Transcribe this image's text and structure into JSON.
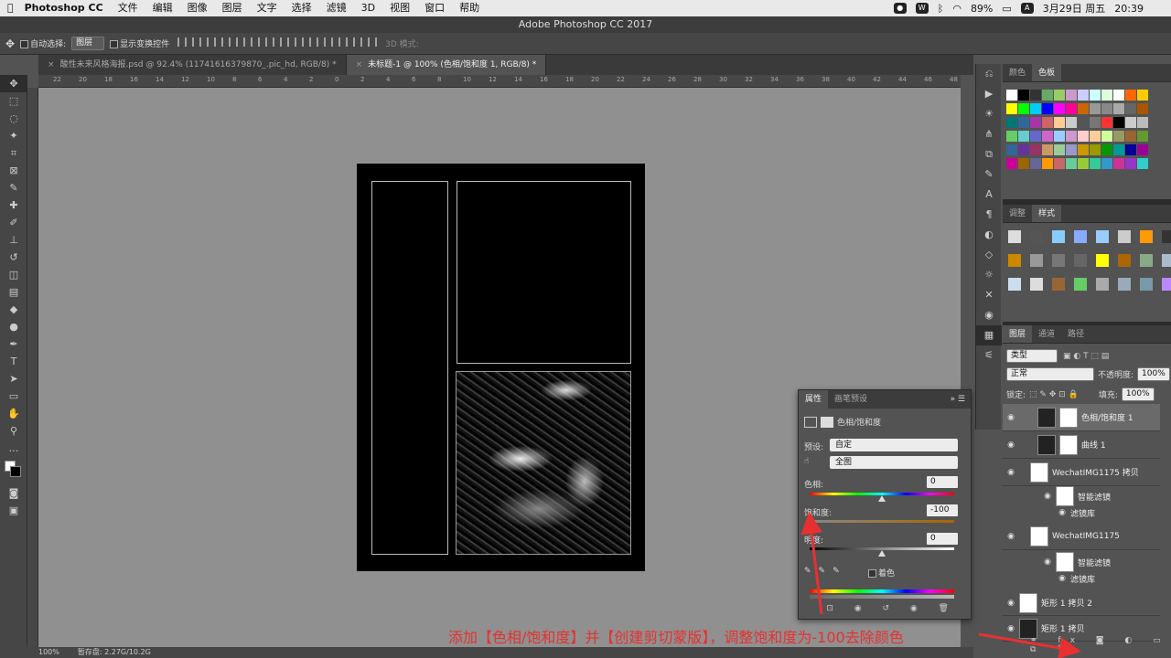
{
  "menubar": {
    "app": "Photoshop CC",
    "items": [
      "文件",
      "编辑",
      "图像",
      "图层",
      "文字",
      "选择",
      "滤镜",
      "3D",
      "视图",
      "窗口",
      "帮助"
    ],
    "battery": "89%",
    "date": "3月29日 周五",
    "time": "20:39",
    "input": "A"
  },
  "window": {
    "title": "Adobe Photoshop CC 2017"
  },
  "options": {
    "auto_select": "自动选择:",
    "layer_select": "图层",
    "show_transform": "显示变换控件",
    "mode3d": "3D 模式:"
  },
  "tabs": [
    {
      "label": "酸性未来风格海报.psd @ 92.4% (11741616379870_.pic_hd, RGB/8) *"
    },
    {
      "label": "未标题-1 @ 100% (色相/饱和度 1, RGB/8) *"
    }
  ],
  "ruler": {
    "marks": [
      "22",
      "20",
      "18",
      "16",
      "14",
      "12",
      "10",
      "8",
      "6",
      "4",
      "2",
      "0",
      "2",
      "4",
      "6",
      "8",
      "10",
      "12",
      "14",
      "16",
      "18",
      "20",
      "22",
      "24",
      "26",
      "28",
      "30",
      "32",
      "34",
      "36",
      "38",
      "40",
      "42",
      "44",
      "46",
      "48"
    ]
  },
  "status": {
    "zoom": "100%",
    "doc": "暂存盘: 2.27G/10.2G"
  },
  "swatches_panel": {
    "tabs": [
      "颜色",
      "色板"
    ]
  },
  "styles_panel": {
    "tabs": [
      "调整",
      "样式"
    ]
  },
  "layers_panel": {
    "tabs": [
      "图层",
      "通道",
      "路径"
    ],
    "filter": "类型",
    "blend": "正常",
    "opacity_label": "不透明度:",
    "opacity": "100%",
    "lock_label": "锁定:",
    "fill_label": "填充:",
    "fill": "100%",
    "layers": [
      {
        "name": "色相/饱和度 1"
      },
      {
        "name": "曲线 1"
      },
      {
        "name": "WechatIMG1175 拷贝"
      },
      {
        "name": "智能滤镜"
      },
      {
        "name": "滤镜库"
      },
      {
        "name": "WechatIMG1175"
      },
      {
        "name": "智能滤镜"
      },
      {
        "name": "滤镜库"
      },
      {
        "name": "矩形 1 拷贝 2"
      },
      {
        "name": "矩形 1 拷贝"
      }
    ]
  },
  "properties": {
    "tabs": [
      "属性",
      "画笔预设"
    ],
    "title": "色相/饱和度",
    "preset_label": "预设:",
    "preset": "自定",
    "channel": "全图",
    "hue_label": "色相:",
    "hue": "0",
    "sat_label": "饱和度:",
    "sat": "-100",
    "light_label": "明度:",
    "light": "0",
    "colorize": "着色",
    "hue_pos": 0.5,
    "sat_pos": 0.0,
    "light_pos": 0.5
  },
  "caption": "添加【色相/饱和度】并【创建剪切蒙版】，调整饱和度为-100去除颜色",
  "colors": {
    "caption": "#e83030",
    "canvas": "#909090",
    "doc": "#000000"
  }
}
